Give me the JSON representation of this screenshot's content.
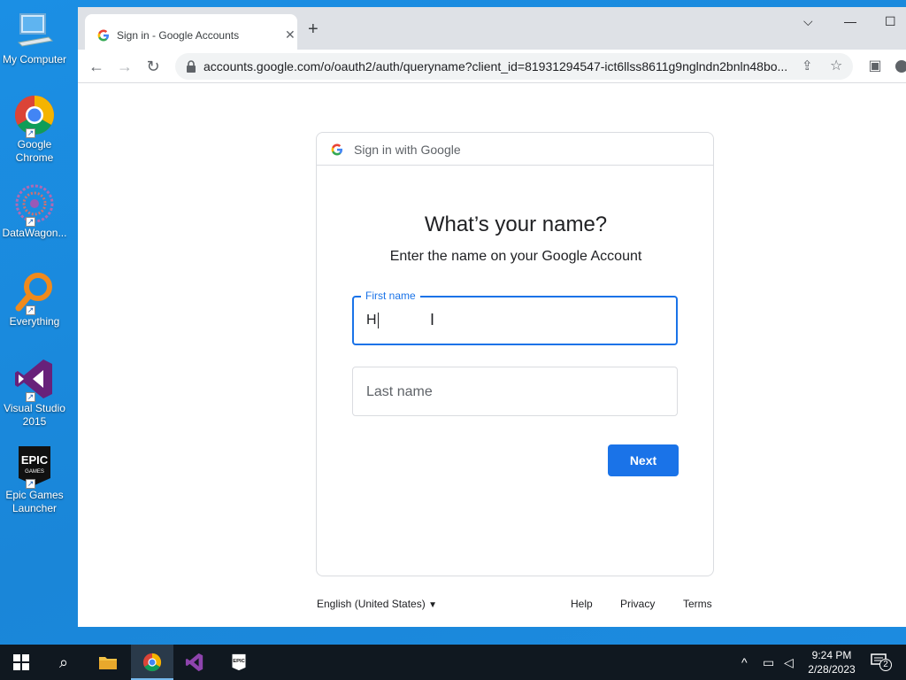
{
  "desktop": {
    "icons": [
      {
        "label": "My Computer"
      },
      {
        "label": "Google Chrome"
      },
      {
        "label": "DataWagon..."
      },
      {
        "label": "Everything"
      },
      {
        "label": "Visual Studio 2015"
      },
      {
        "label": "Epic Games Launcher"
      }
    ]
  },
  "browser": {
    "tab_title": "Sign in - Google Accounts",
    "close_glyph": "✕",
    "new_tab_glyph": "+",
    "url": "accounts.google.com/o/oauth2/auth/queryname?client_id=81931294547-ict6llss8611g9nglndn2bnln48bo...",
    "window_controls": {
      "dropdown": "⌵",
      "minimize": "—",
      "maximize": "☐"
    }
  },
  "card": {
    "header_label": "Sign in with Google",
    "heading": "What’s your name?",
    "subheading": "Enter the name on your Google Account",
    "first_name_label": "First name",
    "first_name_value": "H",
    "last_name_placeholder": "Last name",
    "next_label": "Next"
  },
  "footer": {
    "language": "English (United States)",
    "help": "Help",
    "privacy": "Privacy",
    "terms": "Terms"
  },
  "taskbar": {
    "time": "9:24 PM",
    "date": "2/28/2023",
    "notification_count": "2"
  },
  "colors": {
    "accent": "#1a73e8",
    "desktop": "#1b8fe4",
    "taskbar": "#101820"
  }
}
